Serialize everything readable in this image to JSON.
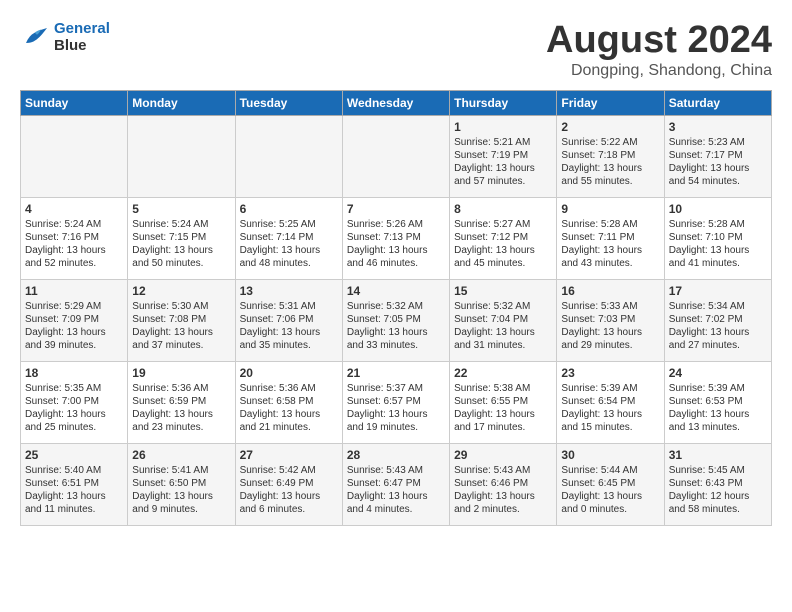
{
  "header": {
    "logo_line1": "General",
    "logo_line2": "Blue",
    "main_title": "August 2024",
    "subtitle": "Dongping, Shandong, China"
  },
  "days_of_week": [
    "Sunday",
    "Monday",
    "Tuesday",
    "Wednesday",
    "Thursday",
    "Friday",
    "Saturday"
  ],
  "weeks": [
    [
      {
        "day": "",
        "content": ""
      },
      {
        "day": "",
        "content": ""
      },
      {
        "day": "",
        "content": ""
      },
      {
        "day": "",
        "content": ""
      },
      {
        "day": "1",
        "content": "Sunrise: 5:21 AM\nSunset: 7:19 PM\nDaylight: 13 hours\nand 57 minutes."
      },
      {
        "day": "2",
        "content": "Sunrise: 5:22 AM\nSunset: 7:18 PM\nDaylight: 13 hours\nand 55 minutes."
      },
      {
        "day": "3",
        "content": "Sunrise: 5:23 AM\nSunset: 7:17 PM\nDaylight: 13 hours\nand 54 minutes."
      }
    ],
    [
      {
        "day": "4",
        "content": "Sunrise: 5:24 AM\nSunset: 7:16 PM\nDaylight: 13 hours\nand 52 minutes."
      },
      {
        "day": "5",
        "content": "Sunrise: 5:24 AM\nSunset: 7:15 PM\nDaylight: 13 hours\nand 50 minutes."
      },
      {
        "day": "6",
        "content": "Sunrise: 5:25 AM\nSunset: 7:14 PM\nDaylight: 13 hours\nand 48 minutes."
      },
      {
        "day": "7",
        "content": "Sunrise: 5:26 AM\nSunset: 7:13 PM\nDaylight: 13 hours\nand 46 minutes."
      },
      {
        "day": "8",
        "content": "Sunrise: 5:27 AM\nSunset: 7:12 PM\nDaylight: 13 hours\nand 45 minutes."
      },
      {
        "day": "9",
        "content": "Sunrise: 5:28 AM\nSunset: 7:11 PM\nDaylight: 13 hours\nand 43 minutes."
      },
      {
        "day": "10",
        "content": "Sunrise: 5:28 AM\nSunset: 7:10 PM\nDaylight: 13 hours\nand 41 minutes."
      }
    ],
    [
      {
        "day": "11",
        "content": "Sunrise: 5:29 AM\nSunset: 7:09 PM\nDaylight: 13 hours\nand 39 minutes."
      },
      {
        "day": "12",
        "content": "Sunrise: 5:30 AM\nSunset: 7:08 PM\nDaylight: 13 hours\nand 37 minutes."
      },
      {
        "day": "13",
        "content": "Sunrise: 5:31 AM\nSunset: 7:06 PM\nDaylight: 13 hours\nand 35 minutes."
      },
      {
        "day": "14",
        "content": "Sunrise: 5:32 AM\nSunset: 7:05 PM\nDaylight: 13 hours\nand 33 minutes."
      },
      {
        "day": "15",
        "content": "Sunrise: 5:32 AM\nSunset: 7:04 PM\nDaylight: 13 hours\nand 31 minutes."
      },
      {
        "day": "16",
        "content": "Sunrise: 5:33 AM\nSunset: 7:03 PM\nDaylight: 13 hours\nand 29 minutes."
      },
      {
        "day": "17",
        "content": "Sunrise: 5:34 AM\nSunset: 7:02 PM\nDaylight: 13 hours\nand 27 minutes."
      }
    ],
    [
      {
        "day": "18",
        "content": "Sunrise: 5:35 AM\nSunset: 7:00 PM\nDaylight: 13 hours\nand 25 minutes."
      },
      {
        "day": "19",
        "content": "Sunrise: 5:36 AM\nSunset: 6:59 PM\nDaylight: 13 hours\nand 23 minutes."
      },
      {
        "day": "20",
        "content": "Sunrise: 5:36 AM\nSunset: 6:58 PM\nDaylight: 13 hours\nand 21 minutes."
      },
      {
        "day": "21",
        "content": "Sunrise: 5:37 AM\nSunset: 6:57 PM\nDaylight: 13 hours\nand 19 minutes."
      },
      {
        "day": "22",
        "content": "Sunrise: 5:38 AM\nSunset: 6:55 PM\nDaylight: 13 hours\nand 17 minutes."
      },
      {
        "day": "23",
        "content": "Sunrise: 5:39 AM\nSunset: 6:54 PM\nDaylight: 13 hours\nand 15 minutes."
      },
      {
        "day": "24",
        "content": "Sunrise: 5:39 AM\nSunset: 6:53 PM\nDaylight: 13 hours\nand 13 minutes."
      }
    ],
    [
      {
        "day": "25",
        "content": "Sunrise: 5:40 AM\nSunset: 6:51 PM\nDaylight: 13 hours\nand 11 minutes."
      },
      {
        "day": "26",
        "content": "Sunrise: 5:41 AM\nSunset: 6:50 PM\nDaylight: 13 hours\nand 9 minutes."
      },
      {
        "day": "27",
        "content": "Sunrise: 5:42 AM\nSunset: 6:49 PM\nDaylight: 13 hours\nand 6 minutes."
      },
      {
        "day": "28",
        "content": "Sunrise: 5:43 AM\nSunset: 6:47 PM\nDaylight: 13 hours\nand 4 minutes."
      },
      {
        "day": "29",
        "content": "Sunrise: 5:43 AM\nSunset: 6:46 PM\nDaylight: 13 hours\nand 2 minutes."
      },
      {
        "day": "30",
        "content": "Sunrise: 5:44 AM\nSunset: 6:45 PM\nDaylight: 13 hours\nand 0 minutes."
      },
      {
        "day": "31",
        "content": "Sunrise: 5:45 AM\nSunset: 6:43 PM\nDaylight: 12 hours\nand 58 minutes."
      }
    ]
  ]
}
